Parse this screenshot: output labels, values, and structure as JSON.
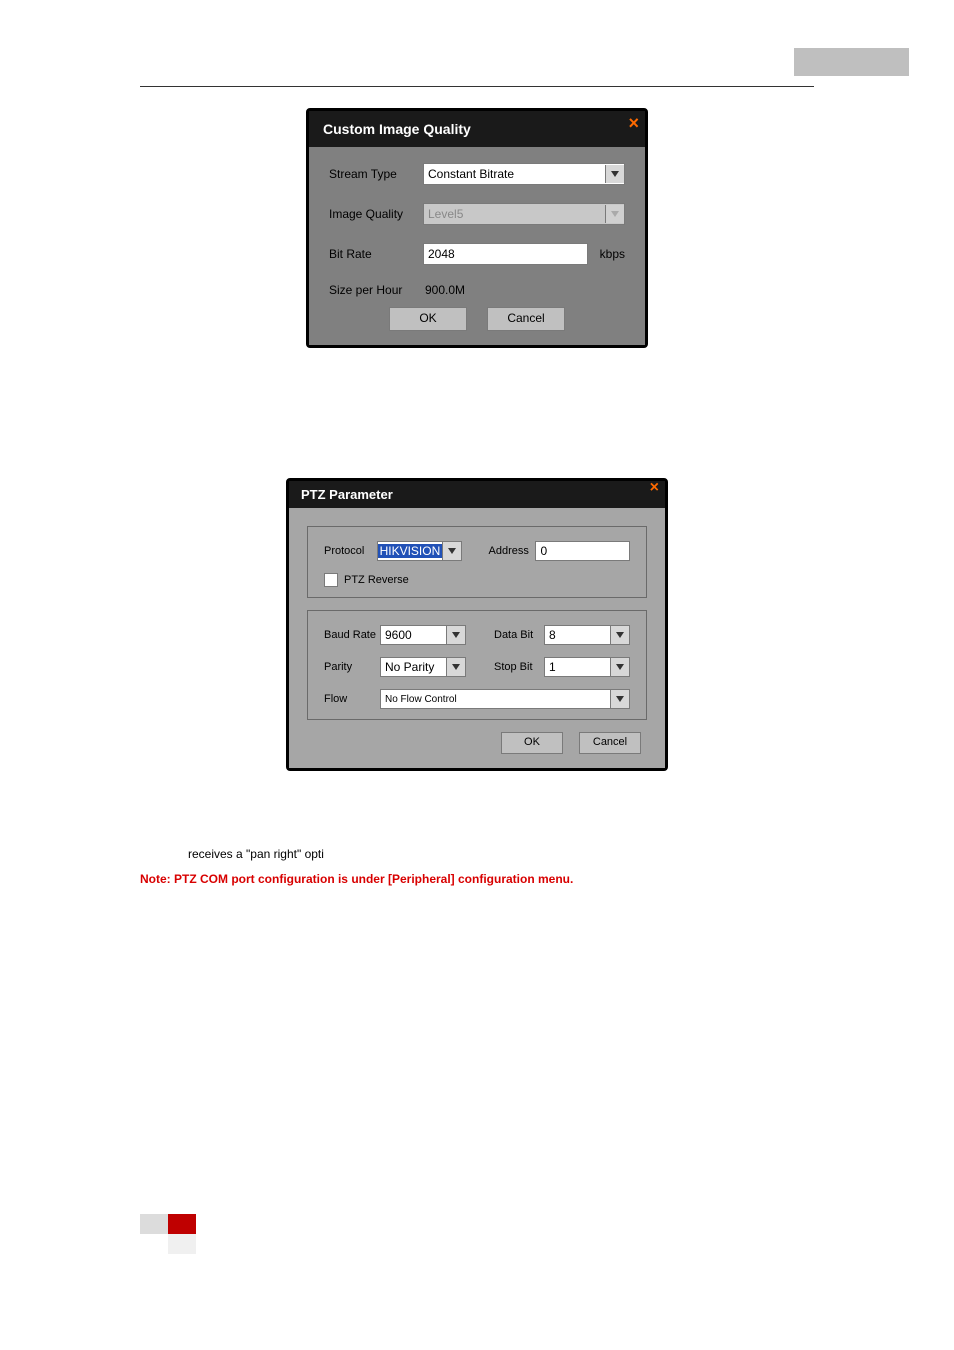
{
  "page": {
    "receives_text": "receives a \"pan right\" opti",
    "note_text": "Note: PTZ COM port configuration is under [Peripheral] configuration menu."
  },
  "ciq": {
    "title": "Custom Image Quality",
    "close": "×",
    "stream_type_label": "Stream Type",
    "stream_type_value": "Constant Bitrate",
    "image_quality_label": "Image Quality",
    "image_quality_value": "Level5",
    "bit_rate_label": "Bit Rate",
    "bit_rate_value": "2048",
    "bit_rate_unit": "kbps",
    "size_label": "Size per Hour",
    "size_value": "900.0M",
    "ok": "OK",
    "cancel": "Cancel"
  },
  "ptz": {
    "title": "PTZ Parameter",
    "close": "×",
    "protocol_label": "Protocol",
    "protocol_value": "HIKVISION",
    "address_label": "Address",
    "address_value": "0",
    "ptz_reverse_label": "PTZ Reverse",
    "baud_label": "Baud Rate",
    "baud_value": "9600",
    "databit_label": "Data Bit",
    "databit_value": "8",
    "parity_label": "Parity",
    "parity_value": "No Parity",
    "stopbit_label": "Stop Bit",
    "stopbit_value": "1",
    "flow_label": "Flow",
    "flow_value": "No Flow Control",
    "ok": "OK",
    "cancel": "Cancel"
  }
}
